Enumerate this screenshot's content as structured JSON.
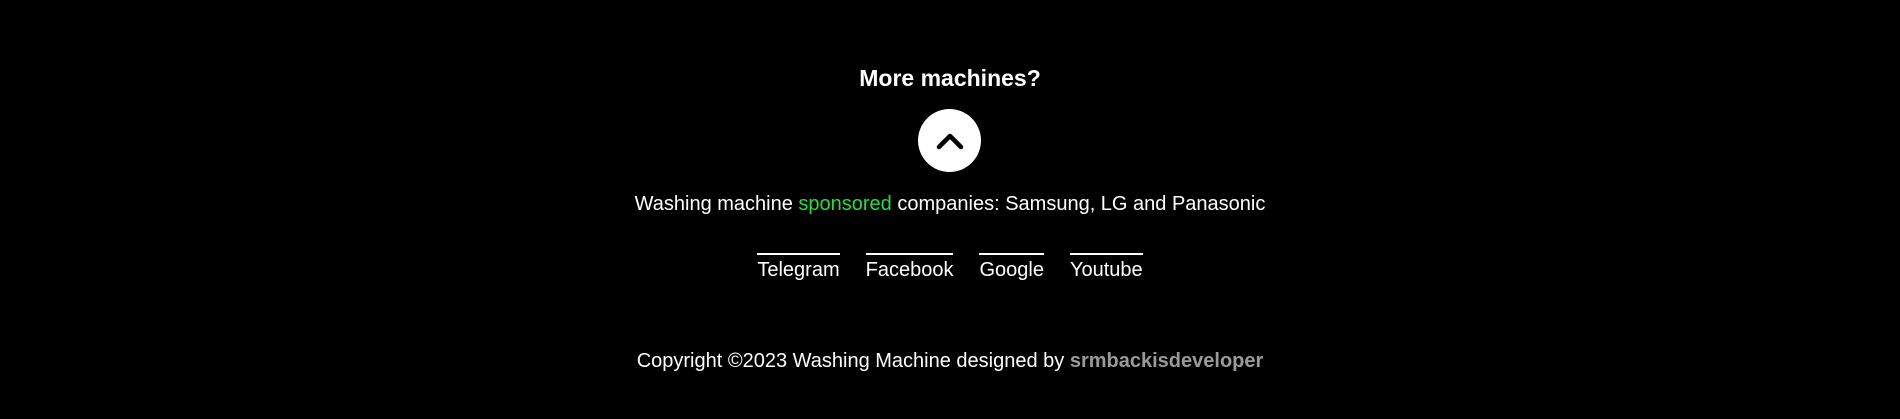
{
  "footer": {
    "heading": "More machines?",
    "up_button_icon": "chevron-up-icon",
    "sponsor": {
      "prefix": "Washing machine ",
      "highlight": "sponsored",
      "suffix": " companies: Samsung, LG and Panasonic"
    },
    "social_links": [
      {
        "label": "Telegram"
      },
      {
        "label": "Facebook"
      },
      {
        "label": "Google"
      },
      {
        "label": "Youtube"
      }
    ],
    "copyright": {
      "text": "Copyright ©2023 Washing Machine designed by ",
      "author": "srmbackisdeveloper"
    }
  },
  "colors": {
    "background": "#000000",
    "text": "#ffffff",
    "accent_green": "#22e03a",
    "author_gray": "#9a9a9a"
  }
}
